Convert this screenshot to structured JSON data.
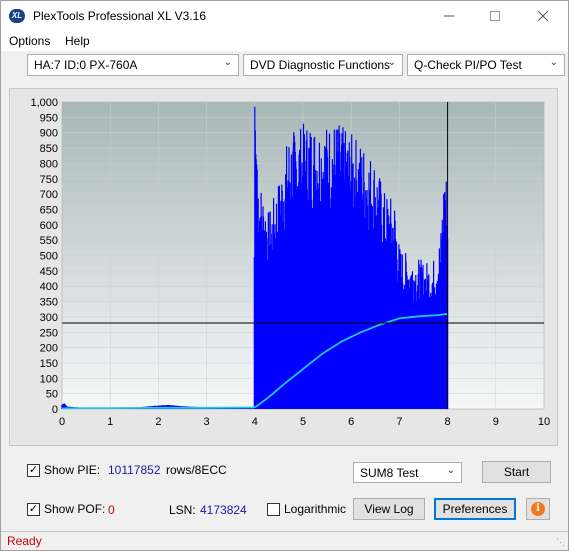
{
  "window": {
    "title": "PlexTools Professional XL V3.16",
    "app_icon_text": "XL",
    "minimize_icon": "minimize-icon",
    "maximize_icon": "maximize-icon",
    "close_icon": "close-icon"
  },
  "menu": {
    "items": [
      "Options",
      "Help"
    ]
  },
  "toolbar": {
    "drive": "HA:7 ID:0  PX-760A",
    "function": "DVD Diagnostic Functions",
    "test": "Q-Check PI/PO Test"
  },
  "chart_data": {
    "type": "bar",
    "x_ticks": [
      "0",
      "1",
      "2",
      "3",
      "4",
      "5",
      "6",
      "7",
      "8",
      "9",
      "10"
    ],
    "y_ticks": [
      "0",
      "50",
      "100",
      "150",
      "200",
      "250",
      "300",
      "350",
      "400",
      "450",
      "500",
      "550",
      "600",
      "650",
      "700",
      "750",
      "800",
      "850",
      "900",
      "950",
      "1,000"
    ],
    "xlim": [
      0,
      10
    ],
    "ylim": [
      0,
      1000
    ],
    "pie_profile": {
      "x": [
        0,
        0.05,
        0.1,
        0.5,
        1.0,
        1.5,
        1.9,
        2.2,
        2.5,
        3.0,
        3.5,
        3.98,
        4.0,
        4.02,
        4.05,
        4.1,
        4.2,
        4.3,
        4.5,
        4.7,
        4.9,
        5.1,
        5.3,
        5.5,
        5.7,
        5.9,
        6.1,
        6.3,
        6.5,
        6.7,
        6.9,
        7.0,
        7.1,
        7.3,
        7.5,
        7.7,
        7.85,
        7.95,
        8.0
      ],
      "y": [
        14,
        18,
        8,
        3,
        3,
        4,
        10,
        13,
        9,
        5,
        4,
        4,
        985,
        830,
        780,
        700,
        650,
        600,
        700,
        840,
        860,
        880,
        870,
        870,
        880,
        850,
        830,
        800,
        760,
        660,
        640,
        500,
        480,
        470,
        450,
        455,
        530,
        780,
        640
      ]
    },
    "pie_total": {
      "x": [
        0,
        0.5,
        1,
        2,
        3,
        3.9,
        3.99,
        4.05,
        4.3,
        4.6,
        5.0,
        5.4,
        5.8,
        6.2,
        6.6,
        7.0,
        7.4,
        7.8,
        8.0
      ],
      "y": [
        2,
        3,
        3,
        4,
        4,
        5,
        5,
        10,
        40,
        80,
        130,
        180,
        220,
        250,
        275,
        295,
        302,
        306,
        310
      ]
    },
    "marker_x": 8,
    "marker_y": 280,
    "colors": {
      "bars": "#0000ff",
      "total": "#1fc8e6",
      "plot_upper": "#aab8b8",
      "plot_lower": "#f4f6f6"
    }
  },
  "controls": {
    "show_pie_label": "Show PIE:",
    "show_pie_checked": "✓",
    "pie_value": "10117852",
    "pie_unit": "rows/8ECC",
    "show_poe_label": "Show POF:",
    "show_poe_checked": "✓",
    "poe_value": "0",
    "lsn_label": "LSN:",
    "lsn_value": "4173824",
    "logarithmic_label": "Logarithmic",
    "sum_select": "SUM8 Test",
    "start_button": "Start",
    "view_log_button": "View Log",
    "preferences_button": "Preferences",
    "info_icon": "i"
  },
  "status": {
    "text": "Ready"
  }
}
